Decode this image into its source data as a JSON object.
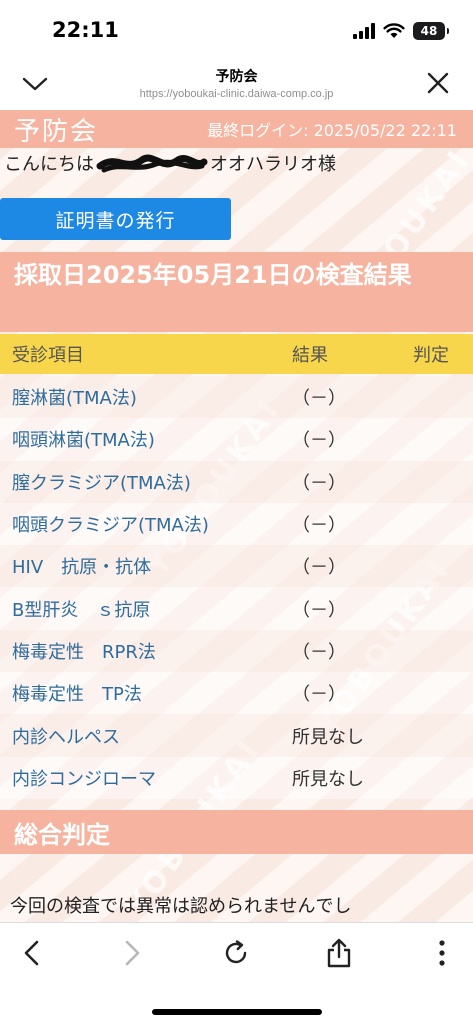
{
  "status": {
    "time": "22:11",
    "battery": "48"
  },
  "nav": {
    "title": "予防会",
    "url": "https://yoboukai-clinic.daiwa-comp.co.jp"
  },
  "site": {
    "logo": "予防会",
    "last_login": "最終ログイン: 2025/05/22 22:11",
    "greeting_prefix": "こんにちは",
    "greeting_suffix": "オオハラリオ様",
    "certificate_button": "証明書の発行",
    "watermark": "YOBOUKAI"
  },
  "results": {
    "heading": "採取日2025年05月21日の検査結果",
    "columns": {
      "item": "受診項目",
      "result": "結果",
      "judgement": "判定"
    },
    "rows": [
      {
        "item": "膣淋菌(TMA法)",
        "result": "（－）"
      },
      {
        "item": "咽頭淋菌(TMA法)",
        "result": "（－）"
      },
      {
        "item": "膣クラミジア(TMA法)",
        "result": "（－）"
      },
      {
        "item": "咽頭クラミジア(TMA法)",
        "result": "（－）"
      },
      {
        "item": "HIV　抗原・抗体",
        "result": "（－）"
      },
      {
        "item": "B型肝炎　ｓ抗原",
        "result": "（－）"
      },
      {
        "item": "梅毒定性　RPR法",
        "result": "（－）"
      },
      {
        "item": "梅毒定性　TP法",
        "result": "（－）"
      },
      {
        "item": "内診ヘルペス",
        "result": "所見なし"
      },
      {
        "item": "内診コンジローマ",
        "result": "所見なし"
      }
    ]
  },
  "summary": {
    "heading": "総合判定",
    "text": "今回の検査では異常は認められませんでし"
  },
  "colors": {
    "header_salmon": "#f6b4a0",
    "column_header_yellow": "#f8d64c",
    "button_blue": "#1e88e5",
    "item_link_blue": "#2f6c9e"
  },
  "toolbar": {
    "icons": [
      "back-icon",
      "forward-icon",
      "reload-icon",
      "share-icon",
      "more-icon"
    ]
  }
}
